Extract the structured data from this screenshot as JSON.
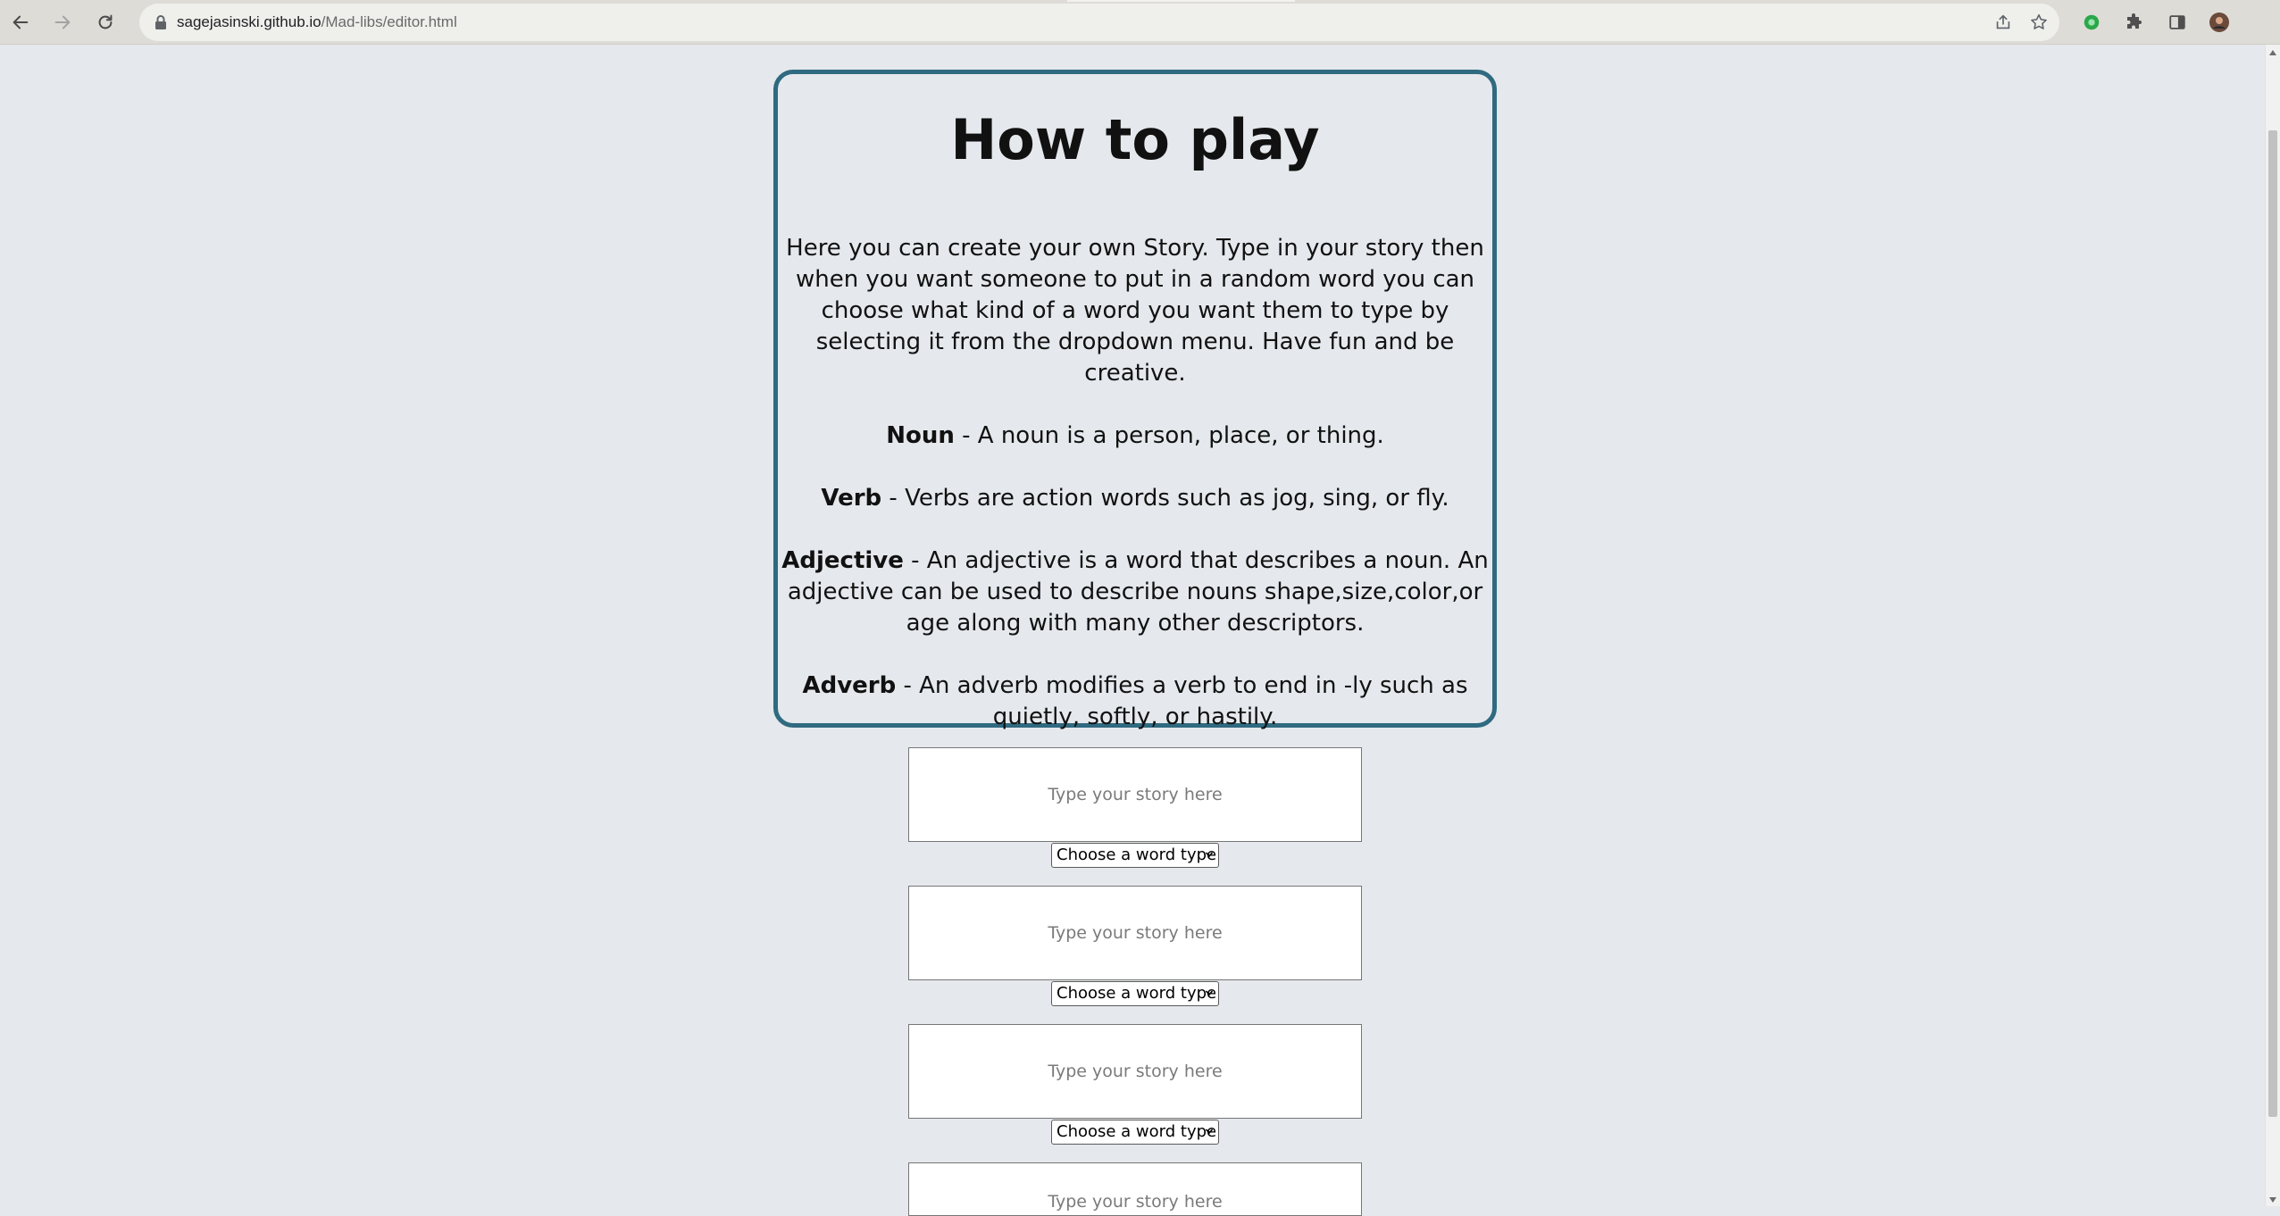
{
  "browser": {
    "url_host": "sagejasinski.github.io",
    "url_path": "/Mad-libs/editor.html",
    "icons": [
      "back-arrow-icon",
      "forward-arrow-icon",
      "reload-icon",
      "lock-icon",
      "share-icon",
      "star-icon",
      "extension-badge-icon",
      "puzzle-icon",
      "side-panel-icon",
      "profile-avatar"
    ]
  },
  "howto": {
    "title": "How to play",
    "intro": "Here you can create your own Story. Type in your story then when you want someone to put in a random word you can choose what kind of a word you want them to type by selecting it from the dropdown menu. Have fun and be creative.",
    "terms": [
      {
        "term": "Noun",
        "definition": " - A noun is a person, place, or thing."
      },
      {
        "term": "Verb",
        "definition": " - Verbs are action words such as jog, sing, or fly."
      },
      {
        "term": "Adjective",
        "definition": " - An adjective is a word that describes a noun. An adjective can be used to describe nouns shape,size,color,or age along with many other descriptors."
      },
      {
        "term": "Adverb",
        "definition": " - An adverb modifies a verb to end in -ly such as quietly, softly, or hastily."
      }
    ]
  },
  "editor": {
    "story_placeholder": "Type your story here",
    "select_label": "Choose a word type",
    "rows": 4
  }
}
